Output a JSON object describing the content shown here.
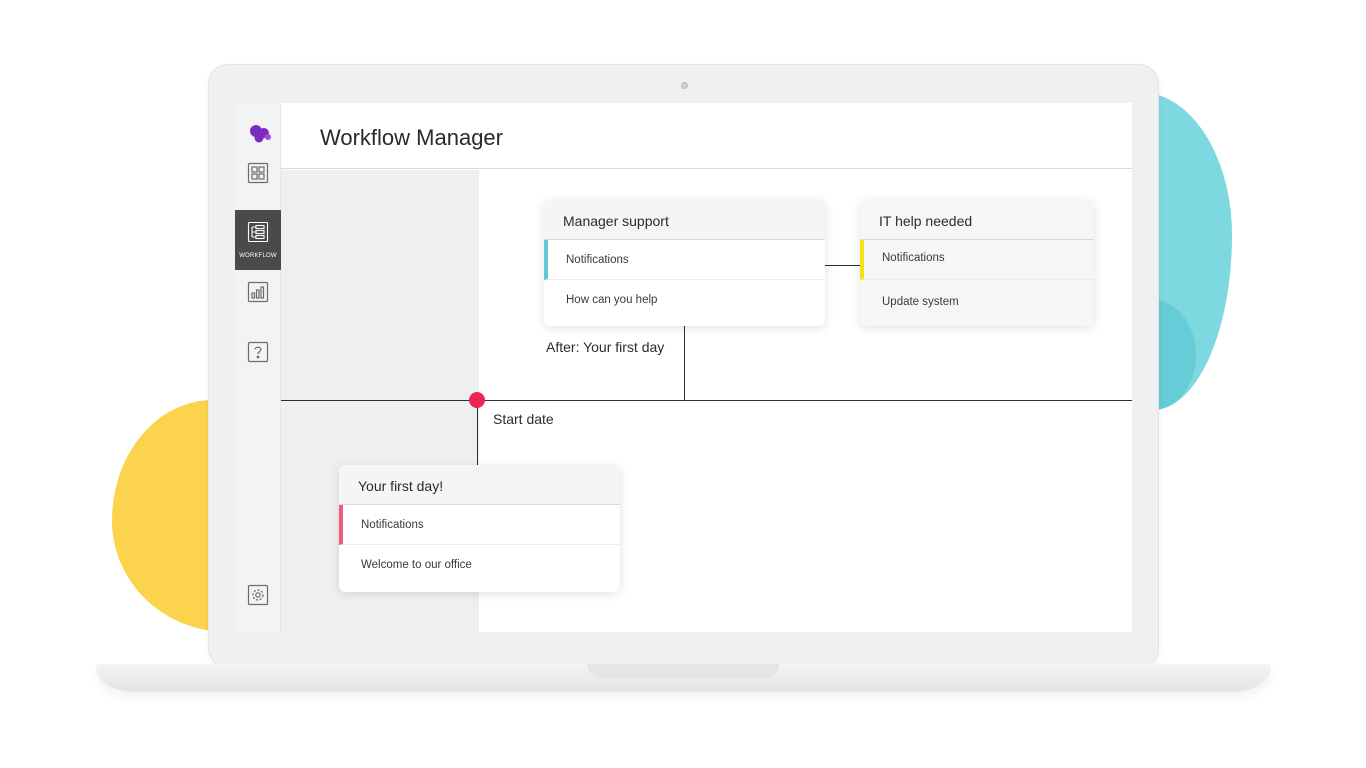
{
  "app": {
    "title": "Workflow Manager"
  },
  "sidebar": {
    "items": [
      {
        "name": "dashboard",
        "icon": "grid-icon"
      },
      {
        "name": "workflow",
        "icon": "workflow-icon",
        "label": "WORKFLOW",
        "active": true
      },
      {
        "name": "reports",
        "icon": "bar-chart-icon"
      },
      {
        "name": "help",
        "icon": "help-icon"
      },
      {
        "name": "settings",
        "icon": "gear-icon"
      }
    ]
  },
  "timeline": {
    "start_label": "Start date",
    "after_label": "After: Your first day"
  },
  "cards": {
    "manager_support": {
      "title": "Manager support",
      "rows": [
        "Notifications",
        "How can you help"
      ],
      "accent": "#5ecbd6"
    },
    "it_help": {
      "title": "IT help needed",
      "rows": [
        "Notifications",
        "Update system"
      ],
      "accent": "#f4e11a"
    },
    "first_day": {
      "title": "Your first day!",
      "rows": [
        "Notifications",
        "Welcome to our office"
      ],
      "accent": "#ef5b7b"
    }
  },
  "colors": {
    "logo": "#7b2cbf",
    "timeline_dot": "#ef2453",
    "sidebar_active": "#4a4a4a",
    "blob_yellow": "#fbd34d",
    "blob_teal": "#7dd8df"
  }
}
